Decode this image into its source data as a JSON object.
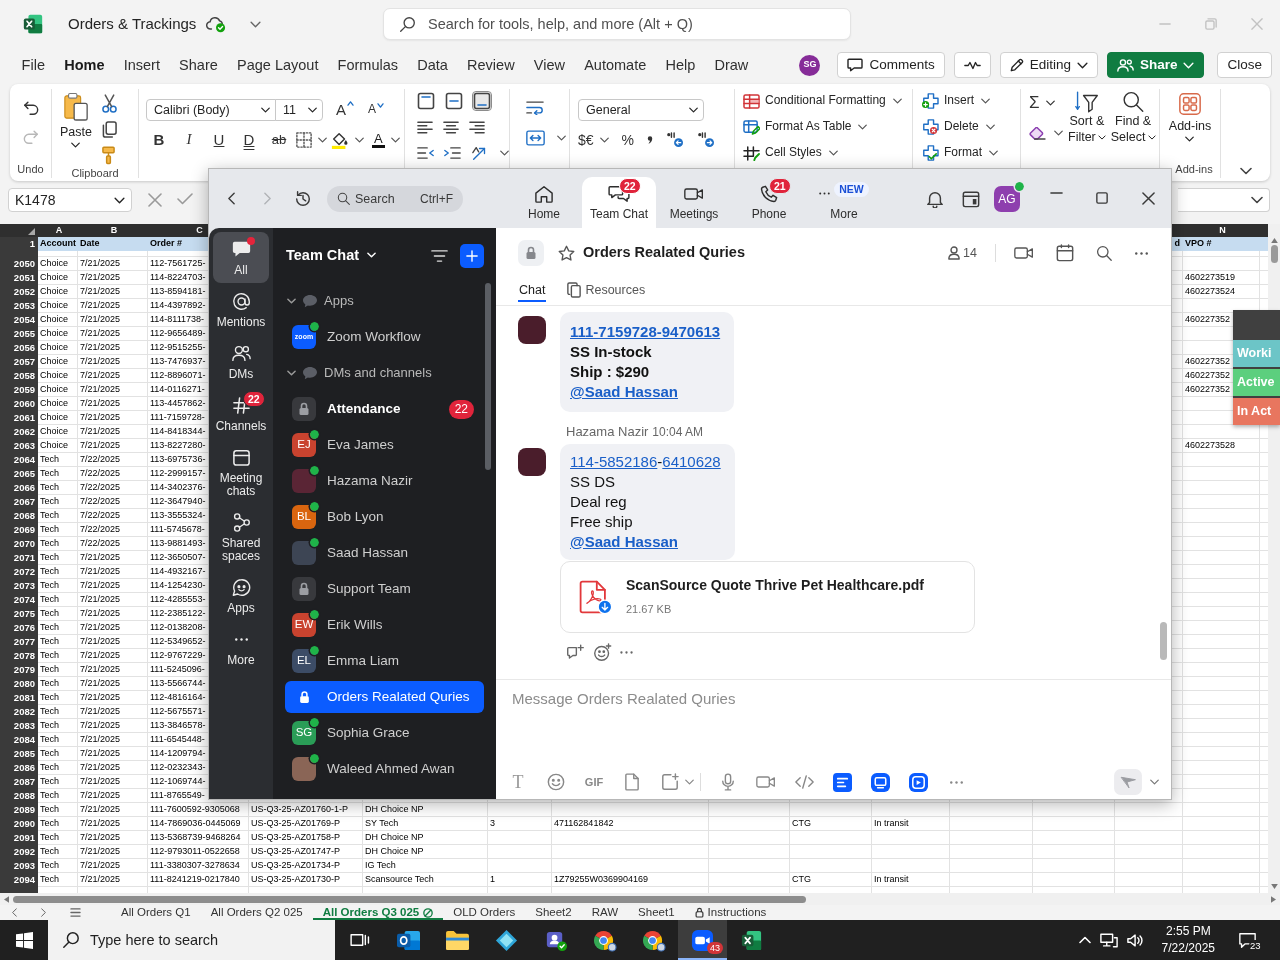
{
  "excel": {
    "title": "Orders & Trackings",
    "search_placeholder": "Search for tools, help, and more (Alt + Q)",
    "menu": [
      {
        "label": "File",
        "selected": false
      },
      {
        "label": "Home",
        "selected": true
      },
      {
        "label": "Insert",
        "selected": false
      },
      {
        "label": "Share",
        "selected": false
      },
      {
        "label": "Page Layout",
        "selected": false
      },
      {
        "label": "Formulas",
        "selected": false
      },
      {
        "label": "Data",
        "selected": false
      },
      {
        "label": "Review",
        "selected": false
      },
      {
        "label": "View",
        "selected": false
      },
      {
        "label": "Automate",
        "selected": false
      },
      {
        "label": "Help",
        "selected": false
      },
      {
        "label": "Draw",
        "selected": false
      }
    ],
    "user_initials": "SG",
    "actions": [
      {
        "kind": "comments",
        "label": "Comments"
      },
      {
        "kind": "activity"
      },
      {
        "kind": "editing",
        "label": "Editing"
      },
      {
        "kind": "share",
        "label": "Share"
      },
      {
        "kind": "close",
        "label": "Close"
      }
    ],
    "ribbon": {
      "undo_label": "Undo",
      "paste": "Paste",
      "clipboard_label": "Clipboard",
      "font": "Calibri (Body)",
      "size": "11",
      "size_buttons": [
        {
          "kind": "grow",
          "label": "A"
        },
        {
          "kind": "shrink",
          "label": "A"
        }
      ],
      "format_buttons": [
        {
          "kind": "bold",
          "label": "B"
        },
        {
          "kind": "italic",
          "label": "I"
        },
        {
          "kind": "underline",
          "label": "U"
        },
        {
          "kind": "double_underline",
          "label": "D"
        },
        {
          "kind": "strike",
          "label": "ab"
        }
      ],
      "font_color": "A",
      "vertical_align": [
        {
          "kind": "top",
          "selected": false
        },
        {
          "kind": "middle",
          "selected": false
        },
        {
          "kind": "bottom",
          "selected": true
        }
      ],
      "number_format": "General",
      "currency": "$€",
      "percent": "%",
      "styles": [
        {
          "kind": "conditional",
          "label": "Conditional Formatting"
        },
        {
          "kind": "table",
          "label": "Format As Table"
        },
        {
          "kind": "cell_styles",
          "label": "Cell Styles"
        }
      ],
      "cells": [
        {
          "kind": "insert",
          "label": "Insert"
        },
        {
          "kind": "delete",
          "label": "Delete"
        },
        {
          "kind": "format",
          "label": "Format"
        }
      ],
      "sum": "Σ",
      "tools": [
        {
          "kind": "sort",
          "lines": [
            "Sort &",
            "Filter"
          ]
        },
        {
          "kind": "find",
          "lines": [
            "Find &",
            "Select"
          ]
        }
      ],
      "addins": "Add-ins",
      "addins_label": "Add-ins"
    },
    "name_box": "K1478",
    "sheet": {
      "column_letters": {
        "A": "A",
        "B": "B",
        "C": "C",
        "N": "N"
      },
      "header_row": {
        "number": "1",
        "cells": {
          "A": "Account",
          "B": "Date",
          "C": "Order #",
          "M": "d",
          "N": "VPO #"
        }
      },
      "rows": [
        {
          "number": "2050",
          "cells": {
            "A": "Choice",
            "B": "7/21/2025",
            "C": "112-7561725-"
          }
        },
        {
          "number": "2051",
          "cells": {
            "A": "Choice",
            "B": "7/21/2025",
            "C": "114-8224703-",
            "N": "4602273519"
          }
        },
        {
          "number": "2052",
          "cells": {
            "A": "Choice",
            "B": "7/21/2025",
            "C": "113-8594181-",
            "N": "4602273524"
          }
        },
        {
          "number": "2053",
          "cells": {
            "A": "Choice",
            "B": "7/21/2025",
            "C": "114-4397892-"
          }
        },
        {
          "number": "2054",
          "cells": {
            "A": "Choice",
            "B": "7/21/2025",
            "C": "114-8111738-",
            "N": "460227352"
          }
        },
        {
          "number": "2055",
          "cells": {
            "A": "Choice",
            "B": "7/21/2025",
            "C": "112-9656489-"
          }
        },
        {
          "number": "2056",
          "cells": {
            "A": "Choice",
            "B": "7/21/2025",
            "C": "112-9515255-"
          }
        },
        {
          "number": "2057",
          "cells": {
            "A": "Choice",
            "B": "7/21/2025",
            "C": "113-7476937-",
            "N": "460227352"
          }
        },
        {
          "number": "2058",
          "cells": {
            "A": "Choice",
            "B": "7/21/2025",
            "C": "112-8896071-",
            "N": "460227352"
          }
        },
        {
          "number": "2059",
          "cells": {
            "A": "Choice",
            "B": "7/21/2025",
            "C": "114-0116271-",
            "N": "460227352"
          }
        },
        {
          "number": "2060",
          "cells": {
            "A": "Choice",
            "B": "7/21/2025",
            "C": "113-4457862-"
          }
        },
        {
          "number": "2061",
          "cells": {
            "A": "Choice",
            "B": "7/21/2025",
            "C": "111-7159728-"
          }
        },
        {
          "number": "2062",
          "cells": {
            "A": "Choice",
            "B": "7/21/2025",
            "C": "114-8418344-"
          }
        },
        {
          "number": "2063",
          "cells": {
            "A": "Choice",
            "B": "7/21/2025",
            "C": "113-8227280-",
            "N": "4602273528"
          }
        },
        {
          "number": "2064",
          "cells": {
            "A": "Tech",
            "B": "7/22/2025",
            "C": "113-6975736-"
          }
        },
        {
          "number": "2065",
          "cells": {
            "A": "Tech",
            "B": "7/22/2025",
            "C": "112-2999157-"
          }
        },
        {
          "number": "2066",
          "cells": {
            "A": "Tech",
            "B": "7/22/2025",
            "C": "114-3402376-"
          }
        },
        {
          "number": "2067",
          "cells": {
            "A": "Tech",
            "B": "7/22/2025",
            "C": "112-3647940-"
          }
        },
        {
          "number": "2068",
          "cells": {
            "A": "Tech",
            "B": "7/22/2025",
            "C": "113-3555324-"
          }
        },
        {
          "number": "2069",
          "cells": {
            "A": "Tech",
            "B": "7/22/2025",
            "C": "111-5745678-"
          }
        },
        {
          "number": "2070",
          "cells": {
            "A": "Tech",
            "B": "7/22/2025",
            "C": "113-9881493-"
          }
        },
        {
          "number": "2071",
          "cells": {
            "A": "Tech",
            "B": "7/21/2025",
            "C": "112-3650507-"
          }
        },
        {
          "number": "2072",
          "cells": {
            "A": "Tech",
            "B": "7/21/2025",
            "C": "114-4932167-"
          }
        },
        {
          "number": "2073",
          "cells": {
            "A": "Tech",
            "B": "7/21/2025",
            "C": "114-1254230-"
          }
        },
        {
          "number": "2074",
          "cells": {
            "A": "Tech",
            "B": "7/21/2025",
            "C": "112-4285553-"
          }
        },
        {
          "number": "2075",
          "cells": {
            "A": "Tech",
            "B": "7/21/2025",
            "C": "112-2385122-"
          }
        },
        {
          "number": "2076",
          "cells": {
            "A": "Tech",
            "B": "7/21/2025",
            "C": "112-0138208-"
          }
        },
        {
          "number": "2077",
          "cells": {
            "A": "Tech",
            "B": "7/21/2025",
            "C": "112-5349652-"
          }
        },
        {
          "number": "2078",
          "cells": {
            "A": "Tech",
            "B": "7/21/2025",
            "C": "112-9767229-"
          }
        },
        {
          "number": "2079",
          "cells": {
            "A": "Tech",
            "B": "7/21/2025",
            "C": "111-5245096-"
          }
        },
        {
          "number": "2080",
          "cells": {
            "A": "Tech",
            "B": "7/21/2025",
            "C": "113-5566744-"
          }
        },
        {
          "number": "2081",
          "cells": {
            "A": "Tech",
            "B": "7/21/2025",
            "C": "112-4816164-"
          }
        },
        {
          "number": "2082",
          "cells": {
            "A": "Tech",
            "B": "7/21/2025",
            "C": "112-5675571-"
          }
        },
        {
          "number": "2083",
          "cells": {
            "A": "Tech",
            "B": "7/21/2025",
            "C": "113-3846578-"
          }
        },
        {
          "number": "2084",
          "cells": {
            "A": "Tech",
            "B": "7/21/2025",
            "C": "111-6545448-"
          }
        },
        {
          "number": "2085",
          "cells": {
            "A": "Tech",
            "B": "7/21/2025",
            "C": "114-1209794-"
          }
        },
        {
          "number": "2086",
          "cells": {
            "A": "Tech",
            "B": "7/21/2025",
            "C": "112-0232343-"
          }
        },
        {
          "number": "2087",
          "cells": {
            "A": "Tech",
            "B": "7/21/2025",
            "C": "112-1069744-"
          }
        },
        {
          "number": "2088",
          "cells": {
            "A": "Tech",
            "B": "7/21/2025",
            "C": "111-8765549-"
          }
        },
        {
          "number": "2089",
          "cells": {
            "A": "Tech",
            "B": "7/21/2025",
            "C": "111-7600592-9305068",
            "D": "US-Q3-25-AZ01760-1-P",
            "E": "DH Choice NP"
          }
        },
        {
          "number": "2090",
          "cells": {
            "A": "Tech",
            "B": "7/21/2025",
            "C": "114-7869036-0445069",
            "D": "US-Q3-25-AZ01769-P",
            "E": "SY Tech",
            "F": "3",
            "G": "471162841842",
            "I": "CTG",
            "J": "In transit"
          }
        },
        {
          "number": "2091",
          "cells": {
            "A": "Tech",
            "B": "7/21/2025",
            "C": "113-5368739-9468264",
            "D": "US-Q3-25-AZ01758-P",
            "E": "DH Choice NP"
          }
        },
        {
          "number": "2092",
          "cells": {
            "A": "Tech",
            "B": "7/21/2025",
            "C": "112-9793011-0522658",
            "D": "US-Q3-25-AZ01747-P",
            "E": "DH Choice NP"
          }
        },
        {
          "number": "2093",
          "cells": {
            "A": "Tech",
            "B": "7/21/2025",
            "C": "111-3380307-3278634",
            "D": "US-Q3-25-AZ01734-P",
            "E": "IG Tech"
          }
        },
        {
          "number": "2094",
          "cells": {
            "A": "Tech",
            "B": "7/21/2025",
            "C": "111-8241219-0217840",
            "D": "US-Q3-25-AZ01730-P",
            "E": "Scansource Tech",
            "F": "1",
            "G": "1Z79255W0369904169",
            "I": "CTG",
            "J": "In transit"
          }
        }
      ]
    },
    "status_menu": [
      {
        "label": "Worki",
        "color": "#6cc5c7"
      },
      {
        "label": "Active",
        "color": "#5ccf7e"
      },
      {
        "label": "In Act",
        "color": "#e8765f"
      }
    ],
    "sheet_tabs": [
      {
        "label": "All Orders Q1",
        "selected": false,
        "view_icon": false,
        "locked": false
      },
      {
        "label": "All Orders Q2 025",
        "selected": false,
        "view_icon": false,
        "locked": false
      },
      {
        "label": "All Orders Q3 025",
        "selected": true,
        "view_icon": true,
        "locked": false
      },
      {
        "label": "OLD Orders",
        "selected": false,
        "view_icon": false,
        "locked": false
      },
      {
        "label": "Sheet2",
        "selected": false,
        "view_icon": false,
        "locked": false
      },
      {
        "label": "RAW",
        "selected": false,
        "view_icon": false,
        "locked": false
      },
      {
        "label": "Sheet1",
        "selected": false,
        "view_icon": false,
        "locked": false
      },
      {
        "label": "Instructions",
        "selected": false,
        "view_icon": false,
        "locked": true
      }
    ]
  },
  "zoom": {
    "search_placeholder": "Search",
    "search_shortcut": "Ctrl+F",
    "nav": [
      {
        "kind": "home",
        "label": "Home",
        "selected": false
      },
      {
        "kind": "chat",
        "label": "Team Chat",
        "selected": true,
        "badge": "22"
      },
      {
        "kind": "meetings",
        "label": "Meetings",
        "selected": false
      },
      {
        "kind": "phone",
        "label": "Phone",
        "selected": false,
        "badge": "21"
      },
      {
        "kind": "more",
        "label": "More",
        "selected": false,
        "tag": "NEW"
      }
    ],
    "user_initials": "AG",
    "user_online": true,
    "rail": [
      {
        "kind": "all",
        "label": "All",
        "selected": true,
        "unread_dot": true
      },
      {
        "kind": "mentions",
        "label": "Mentions",
        "selected": false,
        "unread_dot": false
      },
      {
        "kind": "dms",
        "label": "DMs",
        "selected": false,
        "unread_dot": false
      },
      {
        "kind": "channels",
        "label": "Channels",
        "selected": false,
        "unread_dot": false,
        "badge": "22"
      },
      {
        "kind": "meeting_chats",
        "label": "Meeting chats",
        "selected": false,
        "unread_dot": false
      },
      {
        "kind": "shared_spaces",
        "label": "Shared spaces",
        "selected": false,
        "unread_dot": false
      },
      {
        "kind": "apps",
        "label": "Apps",
        "selected": false,
        "unread_dot": false
      },
      {
        "kind": "more",
        "label": "More",
        "selected": false,
        "unread_dot": false
      }
    ],
    "list_title": "Team Chat",
    "sections": [
      {
        "label": "Apps",
        "expanded": true,
        "items": [
          {
            "kind": "app",
            "name": "Zoom Workflow",
            "logo_text": "zoom",
            "online": true,
            "selected": false,
            "unread": false
          }
        ]
      },
      {
        "label": "DMs and channels",
        "expanded": true,
        "items": [
          {
            "kind": "channel",
            "name": "Attendance",
            "online": false,
            "selected": false,
            "unread": true,
            "badge": "22"
          },
          {
            "kind": "person",
            "name": "Eva James",
            "initials": "EJ",
            "color": "#c9432f",
            "online": true,
            "selected": false,
            "unread": false
          },
          {
            "kind": "photo",
            "name": "Hazama Nazir",
            "color": "#5a2535",
            "online": true,
            "selected": false,
            "unread": false
          },
          {
            "kind": "person",
            "name": "Bob Lyon",
            "initials": "BL",
            "color": "#d9650f",
            "online": true,
            "selected": false,
            "unread": false
          },
          {
            "kind": "photo",
            "name": "Saad Hassan",
            "color": "#3d4554",
            "online": true,
            "selected": false,
            "unread": false
          },
          {
            "kind": "channel",
            "name": "Support Team",
            "online": false,
            "selected": false,
            "unread": false
          },
          {
            "kind": "person",
            "name": "Erik Wills",
            "initials": "EW",
            "color": "#c9432f",
            "online": true,
            "selected": false,
            "unread": false
          },
          {
            "kind": "person",
            "name": "Emma Liam",
            "initials": "EL",
            "color": "#3c4c66",
            "online": true,
            "selected": false,
            "unread": false
          },
          {
            "kind": "channel",
            "name": "Orders Realated Quries",
            "online": false,
            "selected": true,
            "unread": false
          },
          {
            "kind": "person",
            "name": "Sophia Grace",
            "initials": "SG",
            "color": "#2a9d57",
            "online": true,
            "selected": false,
            "unread": false
          },
          {
            "kind": "photo",
            "name": "Waleed Ahmed Awan",
            "color": "#8a6556",
            "online": true,
            "selected": false,
            "unread": false
          }
        ]
      }
    ],
    "channel": {
      "title": "Orders Realated Quries",
      "members": "14",
      "tabs": [
        {
          "kind": "chat",
          "label": "Chat",
          "selected": true
        },
        {
          "kind": "resources",
          "label": "Resources",
          "selected": false
        }
      ]
    },
    "messages": [
      {
        "bold": true,
        "lines": [
          [
            {
              "kind": "link",
              "text": "111-7159728-9470613"
            }
          ],
          [
            {
              "kind": "text",
              "text": "SS In-stock"
            }
          ],
          [
            {
              "kind": "text",
              "text": "Ship : $290"
            }
          ],
          [
            {
              "kind": "mention",
              "text": "@Saad Hassan"
            }
          ]
        ]
      },
      {
        "sender": "Hazama Nazir",
        "time": "10:04 AM",
        "bold": false,
        "lines": [
          [
            {
              "kind": "link",
              "text": "114-5852186"
            },
            {
              "kind": "text",
              "text": "-"
            },
            {
              "kind": "link",
              "text": "6410628"
            }
          ],
          [
            {
              "kind": "text",
              "text": "SS DS"
            }
          ],
          [
            {
              "kind": "text",
              "text": "Deal reg"
            }
          ],
          [
            {
              "kind": "text",
              "text": "Free ship"
            }
          ],
          [
            {
              "kind": "mention",
              "text": "@Saad Hassan"
            }
          ]
        ]
      }
    ],
    "attachment": {
      "name": "ScanSource Quote Thrive Pet Healthcare.pdf",
      "size": "21.67 KB"
    },
    "composer": {
      "placeholder": "Message Orders Realated Quries",
      "format_label": "T",
      "gif_label": "GIF"
    }
  },
  "taskbar": {
    "search_placeholder": "Type here to search",
    "apps": [
      {
        "kind": "task_view",
        "active": false
      },
      {
        "kind": "outlook",
        "active": false
      },
      {
        "kind": "explorer",
        "active": false
      },
      {
        "kind": "diamond_app",
        "active": false
      },
      {
        "kind": "teams",
        "active": false
      },
      {
        "kind": "chrome",
        "active": false
      },
      {
        "kind": "chrome",
        "active": false
      },
      {
        "kind": "zoom",
        "active": true,
        "badge": "43"
      },
      {
        "kind": "excel",
        "active": false
      }
    ],
    "time": "2:55 PM",
    "date": "7/22/2025",
    "notifications": "23"
  }
}
